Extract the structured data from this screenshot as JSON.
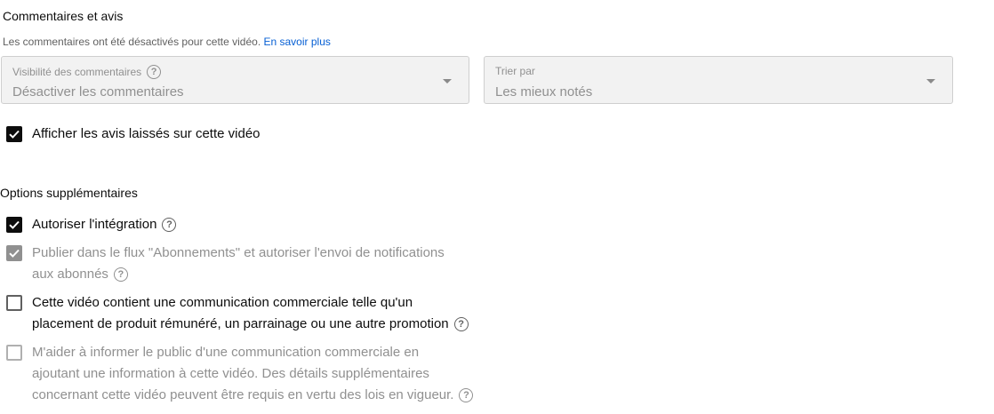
{
  "comments": {
    "title": "Commentaires et avis",
    "note": "Les commentaires ont été désactivés pour cette vidéo.",
    "learn_more": "En savoir plus",
    "visibility": {
      "label": "Visibilité des commentaires",
      "value": "Désactiver les commentaires"
    },
    "sort": {
      "label": "Trier par",
      "value": "Les mieux notés"
    },
    "show_reviews": {
      "label": "Afficher les avis laissés sur cette vidéo",
      "checked": true
    }
  },
  "options": {
    "title": "Options supplémentaires",
    "items": [
      {
        "line1": "Autoriser l'intégration",
        "line2": "",
        "line3": "",
        "state": "checked",
        "help": true
      },
      {
        "line1": "Publier dans le flux \"Abonnements\" et autoriser l'envoi de notifications",
        "line2": "aux abonnés",
        "line3": "",
        "state": "checked-disabled",
        "help": true
      },
      {
        "line1": "Cette vidéo contient une communication commerciale telle qu'un",
        "line2": "placement de produit rémunéré, un parrainage ou une autre promotion",
        "line3": "",
        "state": "unchecked",
        "help": true
      },
      {
        "line1": "M'aider à informer le public d'une communication commerciale en",
        "line2": "ajoutant une information à cette vidéo. Des détails supplémentaires",
        "line3": "concernant cette vidéo peuvent être requis en vertu des lois en vigueur.",
        "state": "unchecked-disabled",
        "help": true
      }
    ]
  },
  "colors": {
    "link": "#065fd4",
    "checked": "#0d0d0d",
    "disabled": "#909090"
  }
}
